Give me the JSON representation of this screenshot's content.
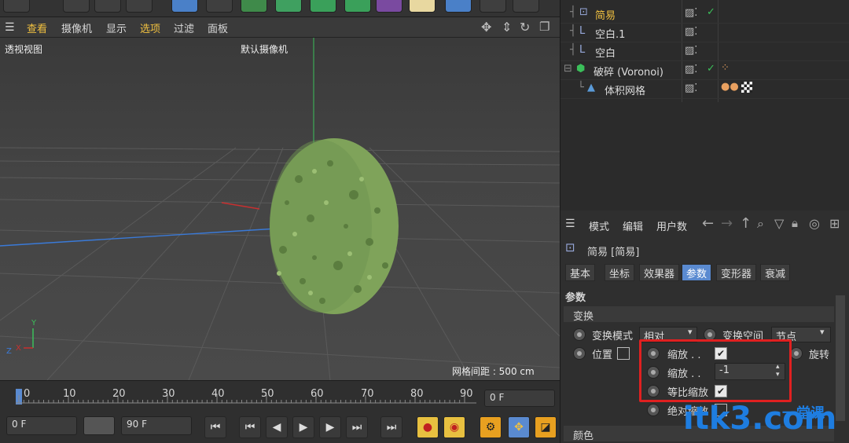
{
  "viewport_menu": {
    "items": [
      "查看",
      "摄像机",
      "显示",
      "选项",
      "过滤",
      "面板"
    ],
    "highlighted": [
      "查看",
      "选项"
    ]
  },
  "viewport": {
    "view_label": "透视视图",
    "camera_label": "默认摄像机",
    "grid_spacing": "网格间距 : 500 cm"
  },
  "timeline": {
    "ticks": [
      "0",
      "10",
      "20",
      "30",
      "40",
      "50",
      "60",
      "70",
      "80",
      "90"
    ],
    "current_frame": "0 F",
    "start_frame": "0 F",
    "end_frame": "90 F"
  },
  "objects": [
    {
      "name": "简易",
      "selected": true
    },
    {
      "name": "空白.1"
    },
    {
      "name": "空白"
    },
    {
      "name": "破碎 (Voronoi)"
    },
    {
      "name": "体积网格"
    }
  ],
  "attributes": {
    "menu": [
      "模式",
      "编辑",
      "用户数"
    ],
    "object_title": "简易 [简易]",
    "tabs": [
      "基本",
      "坐标",
      "效果器",
      "参数",
      "变形器",
      "衰减"
    ],
    "active_tab": "参数",
    "section": "参数",
    "group": "变换",
    "transform_mode_label": "变换模式",
    "transform_mode_value": "相对",
    "transform_space_label": "变换空间",
    "transform_space_value": "节点",
    "position_label": "位置",
    "scale1_label": "缩放 . .",
    "scale2_label": "缩放 . .",
    "scale2_value": "-1",
    "uniform_scale_label": "等比缩放",
    "absolute_scale_label": "绝对缩放",
    "rotation_label": "旋转",
    "color_group": "颜色"
  },
  "watermark": "itk3.com",
  "watermark_sub": "一堂课",
  "colors": {
    "highlight": "#f0c040",
    "active_tab": "#5a8ad0",
    "red_box": "#e02020",
    "object_green": "#7fa35a",
    "watermark": "#1e7de0"
  }
}
